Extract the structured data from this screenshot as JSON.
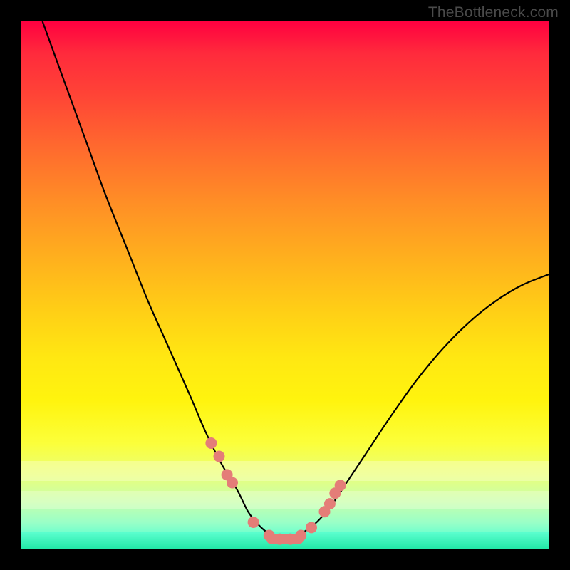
{
  "watermark": "TheBottleneck.com",
  "colors": {
    "frame": "#000000",
    "curve": "#000000",
    "marker_fill": "#e47d78",
    "marker_stroke": "#d8615f"
  },
  "chart_data": {
    "type": "line",
    "title": "",
    "xlabel": "",
    "ylabel": "",
    "xlim": [
      0,
      100
    ],
    "ylim": [
      0,
      100
    ],
    "grid": false,
    "legend": false,
    "series": [
      {
        "name": "bottleneck-curve",
        "x": [
          4,
          8,
          12,
          16,
          20,
          24,
          28,
          32,
          35,
          38,
          41,
          43,
          45,
          47,
          49,
          51,
          53,
          56,
          59,
          62,
          66,
          70,
          75,
          80,
          85,
          90,
          95,
          100
        ],
        "y": [
          100,
          89,
          78,
          67,
          57,
          47,
          38,
          29,
          22,
          16,
          11,
          7,
          4.5,
          2.8,
          1.8,
          1.8,
          2.8,
          5,
          8.5,
          13,
          19,
          25,
          32,
          38,
          43,
          47,
          50,
          52
        ]
      }
    ],
    "markers": {
      "name": "highlight-points",
      "x": [
        36,
        37.5,
        39,
        40,
        44,
        47,
        49,
        51,
        53,
        55,
        57.5,
        58.5,
        59.5,
        60.5
      ],
      "y": [
        20,
        17.5,
        14,
        12.5,
        5,
        2.5,
        1.8,
        1.8,
        2.5,
        4,
        7,
        8.5,
        10.5,
        12
      ]
    }
  }
}
